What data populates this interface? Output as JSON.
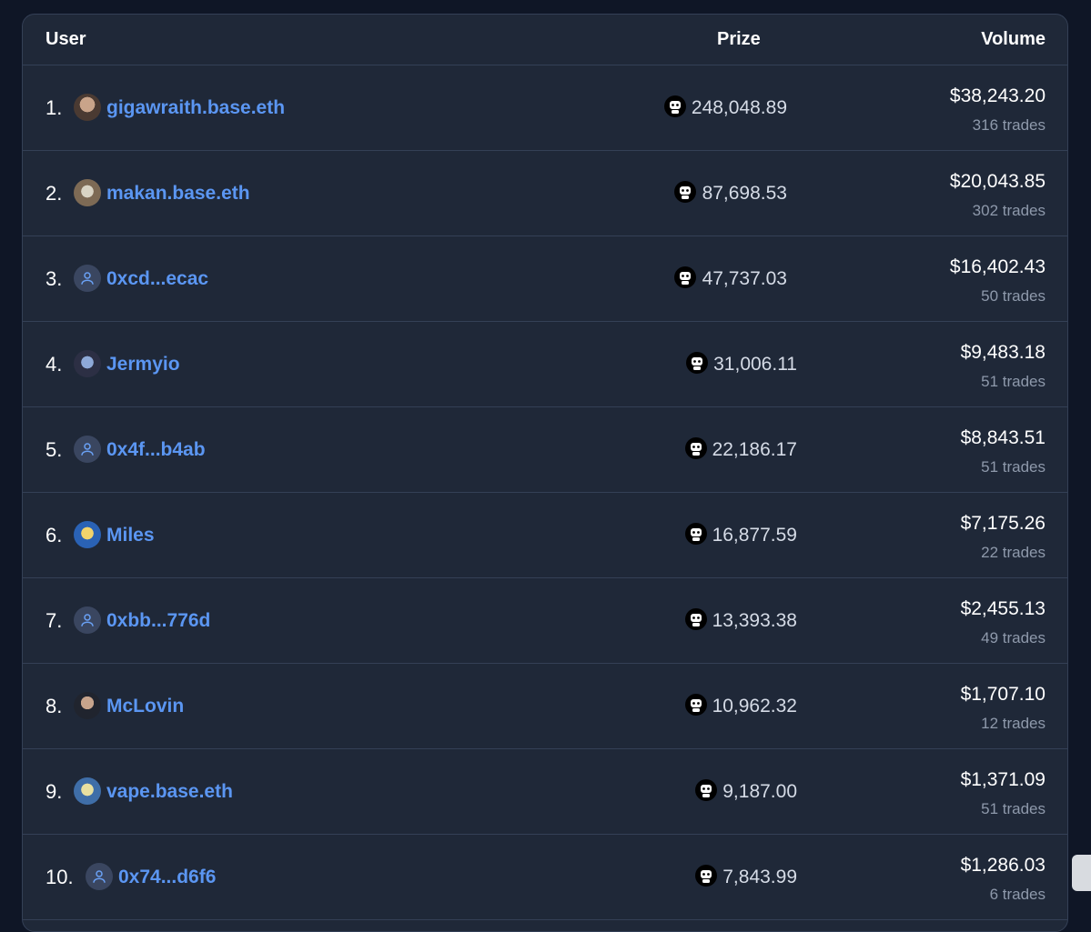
{
  "header": {
    "user": "User",
    "prize": "Prize",
    "volume": "Volume"
  },
  "rows": [
    {
      "rank": "1.",
      "name": "gigawraith.base.eth",
      "prize": "248,048.89",
      "volume": "$38,243.20",
      "trades": "316 trades"
    },
    {
      "rank": "2.",
      "name": "makan.base.eth",
      "prize": "87,698.53",
      "volume": "$20,043.85",
      "trades": "302 trades"
    },
    {
      "rank": "3.",
      "name": "0xcd...ecac",
      "prize": "47,737.03",
      "volume": "$16,402.43",
      "trades": "50 trades"
    },
    {
      "rank": "4.",
      "name": "Jermyio",
      "prize": "31,006.11",
      "volume": "$9,483.18",
      "trades": "51 trades"
    },
    {
      "rank": "5.",
      "name": "0x4f...b4ab",
      "prize": "22,186.17",
      "volume": "$8,843.51",
      "trades": "51 trades"
    },
    {
      "rank": "6.",
      "name": "Miles",
      "prize": "16,877.59",
      "volume": "$7,175.26",
      "trades": "22 trades"
    },
    {
      "rank": "7.",
      "name": "0xbb...776d",
      "prize": "13,393.38",
      "volume": "$2,455.13",
      "trades": "49 trades"
    },
    {
      "rank": "8.",
      "name": "McLovin",
      "prize": "10,962.32",
      "volume": "$1,707.10",
      "trades": "12 trades"
    },
    {
      "rank": "9.",
      "name": "vape.base.eth",
      "prize": "9,187.00",
      "volume": "$1,371.09",
      "trades": "51 trades"
    },
    {
      "rank": "10.",
      "name": "0x74...d6f6",
      "prize": "7,843.99",
      "volume": "$1,286.03",
      "trades": "6 trades"
    }
  ],
  "colors": {
    "background": "#0f1626",
    "panel": "#1f2838",
    "link": "#5b96f2",
    "muted": "#8e99ab"
  },
  "icons": {
    "prize": "robot-token-icon",
    "generic_avatar": "user-icon"
  }
}
